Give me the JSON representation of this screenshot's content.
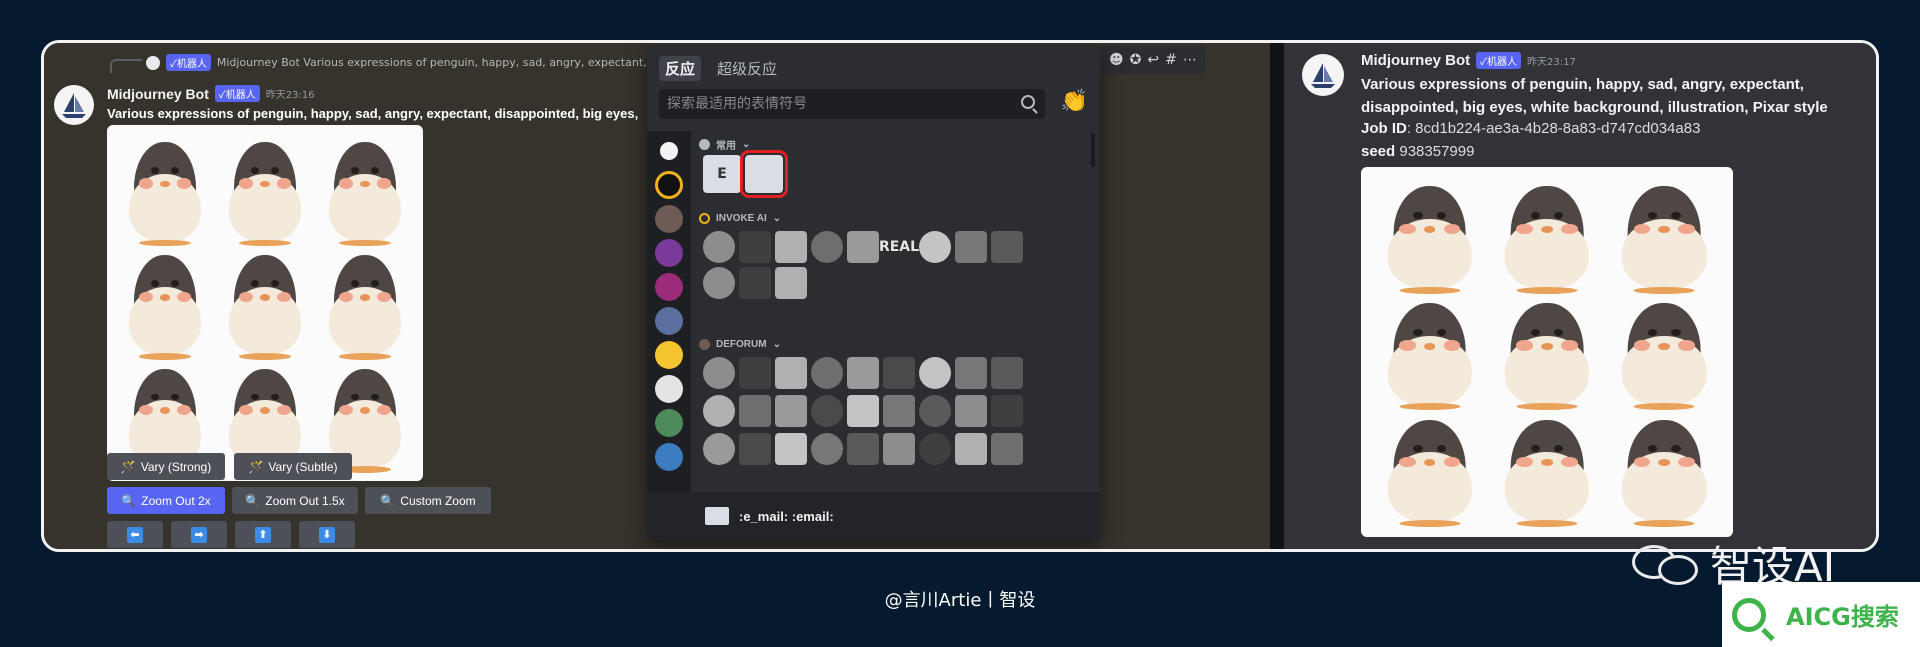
{
  "left_message": {
    "reply_badge": "✓机器人",
    "reply_text": "Midjourney Bot Various expressions of penguin, happy, sad, angry, expectant, disappo",
    "author": "Midjourney Bot",
    "bot_badge": "✓机器人",
    "timestamp": "昨天23:16",
    "prompt": "Various expressions of penguin, happy, sad, angry, expectant, disappointed, big eyes,"
  },
  "buttons": {
    "vary_strong": "Vary (Strong)",
    "vary_subtle": "Vary (Subtle)",
    "zoom_out_2x": "Zoom Out 2x",
    "zoom_out_1_5x": "Zoom Out 1.5x",
    "custom_zoom": "Custom Zoom",
    "arrows": [
      "⬅",
      "➡",
      "⬆",
      "⬇"
    ]
  },
  "picker": {
    "tabs": [
      "反应",
      "超级反应"
    ],
    "search_placeholder": "探索最适用的表情符号",
    "sections": {
      "frequent": "常用",
      "invoke_ai": "INVOKE AI",
      "deforum": "DEFORUM"
    },
    "footer": ":e_mail: :email:",
    "invoke_real_text": "REAL"
  },
  "right_message": {
    "author": "Midjourney Bot",
    "bot_badge": "✓机器人",
    "timestamp": "昨天23:17",
    "prompt": "Various expressions of penguin, happy, sad, angry, expectant, disappointed, big eyes, white background, illustration, Pixar style",
    "job_id_label": "Job ID",
    "job_id_value": ": 8cd1b224-ae3a-4b28-8a83-d747cd034a83",
    "seed_label": "seed",
    "seed_value": " 938357999"
  },
  "watermark": "智设AI",
  "credit": "@言川Artie丨智设",
  "aicg_logo": "AICG搜索"
}
